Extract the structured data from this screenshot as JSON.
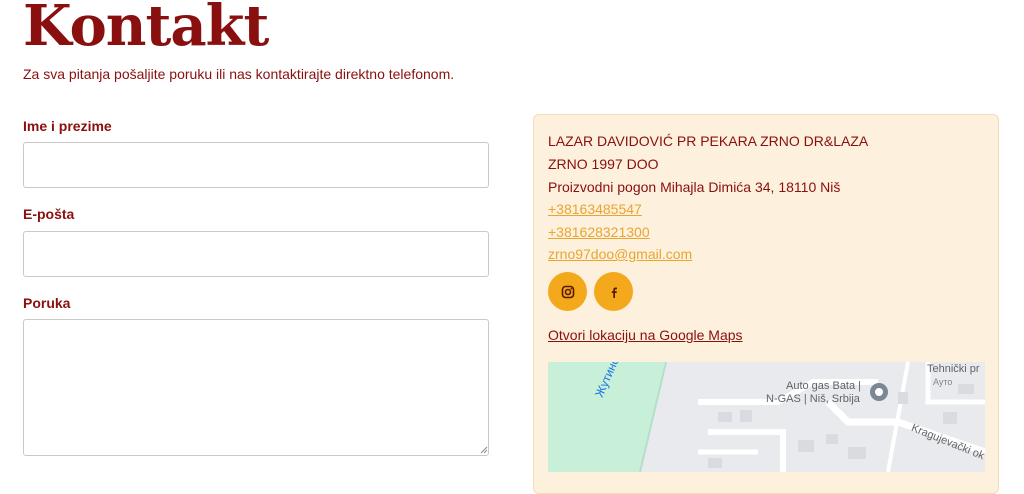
{
  "page": {
    "title": "Kontakt",
    "subtitle": "Za sva pitanja pošaljite poruku ili nas kontaktirajte direktno telefonom."
  },
  "form": {
    "name_label": "Ime i prezime",
    "name_value": "",
    "email_label": "E-pošta",
    "email_value": "",
    "message_label": "Poruka",
    "message_value": ""
  },
  "contact": {
    "company_line1": "LAZAR DAVIDOVIĆ PR PEKARA ZRNO DR&LAZA",
    "company_line2": "ZRNO 1997 DOO",
    "address": "Proizvodni pogon Mihajla Dimića 34, 18110 Niš",
    "phone1": "+38163485547",
    "phone2": "+381628321300",
    "email": "zrno97doo@gmail.com",
    "maps_link": "Otvori lokaciju na Google Maps"
  },
  "social": [
    {
      "icon": "instagram-icon"
    },
    {
      "icon": "facebook-icon"
    }
  ],
  "map": {
    "river_label": "Жутинска река",
    "place_line1": "Auto gas Bata |",
    "place_line2": "N-GAS | Niš, Srbija",
    "top_right_1": "Tehnički pr",
    "top_right_2": "Ауто",
    "street": "Kragujevački ok"
  },
  "colors": {
    "primary": "#8a0f0f",
    "accent": "#f4a81c",
    "card_bg": "#fdf0dd",
    "link": "#e8a530"
  }
}
